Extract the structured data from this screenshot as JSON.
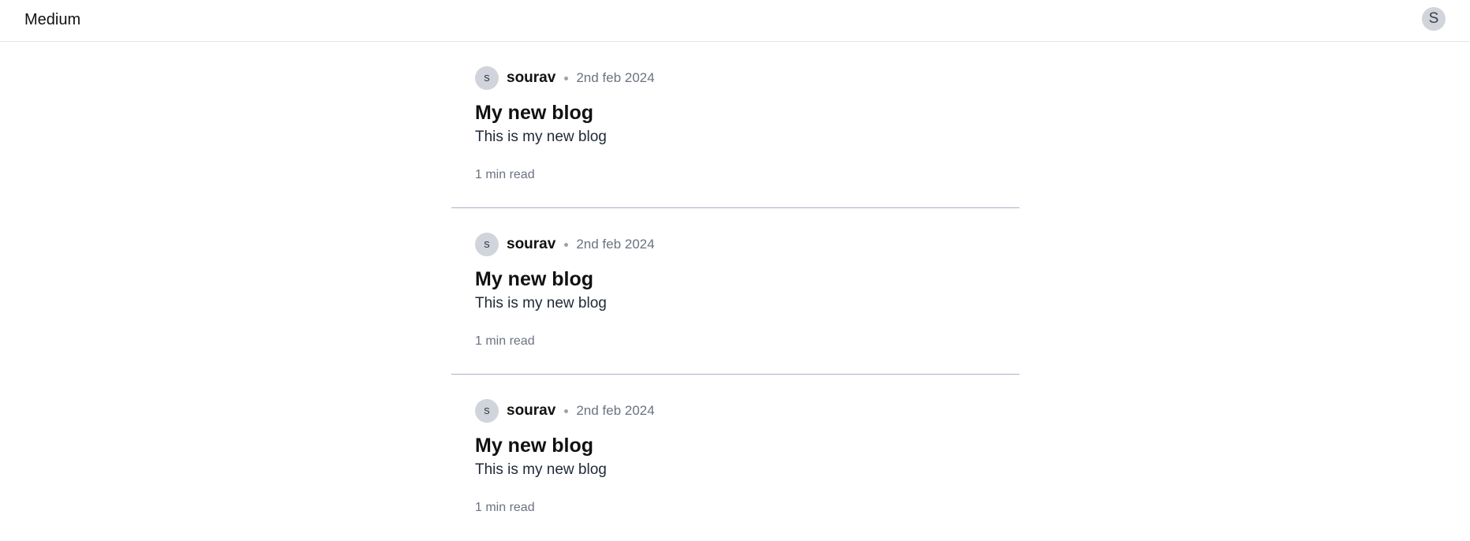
{
  "header": {
    "brand": "Medium",
    "user_avatar_initial": "S"
  },
  "posts": [
    {
      "author_initial": "s",
      "author": "sourav",
      "date": "2nd feb 2024",
      "title": "My new blog",
      "excerpt": "This is my new blog",
      "read_time": "1 min read"
    },
    {
      "author_initial": "s",
      "author": "sourav",
      "date": "2nd feb 2024",
      "title": "My new blog",
      "excerpt": "This is my new blog",
      "read_time": "1 min read"
    },
    {
      "author_initial": "s",
      "author": "sourav",
      "date": "2nd feb 2024",
      "title": "My new blog",
      "excerpt": "This is my new blog",
      "read_time": "1 min read"
    }
  ],
  "colors": {
    "avatar_bg": "#d1d5db",
    "divider": "#a9b1c8",
    "muted_text": "#6b7280"
  }
}
